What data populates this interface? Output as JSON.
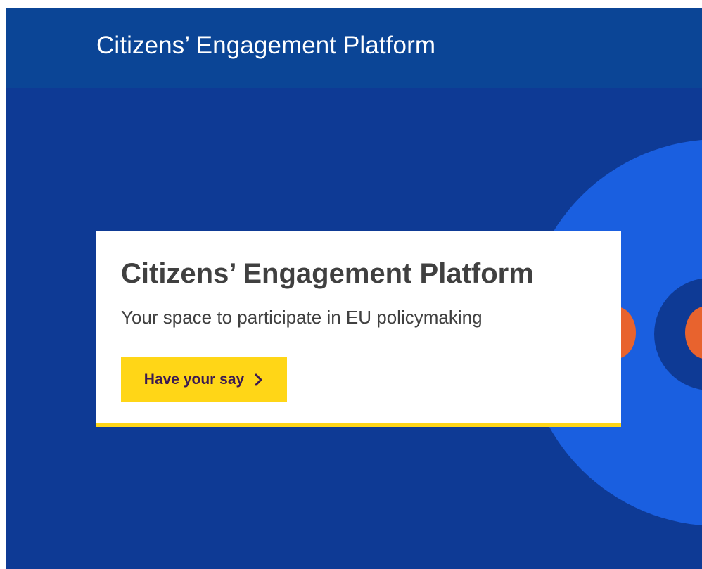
{
  "header": {
    "title": "Citizens’ Engagement Platform"
  },
  "hero": {
    "title": "Citizens’ Engagement Platform",
    "subtitle": "Your space to participate in EU policymaking",
    "cta_label": "Have your say",
    "cta_icon": "chevron-right-icon"
  },
  "colors": {
    "header_bg": "#0b4596",
    "hero_bg": "#0e3a95",
    "accent_yellow": "#ffd617",
    "circle_blue": "#1a5fe0",
    "circle_orange": "#e8632e",
    "button_text": "#3b1a52"
  }
}
